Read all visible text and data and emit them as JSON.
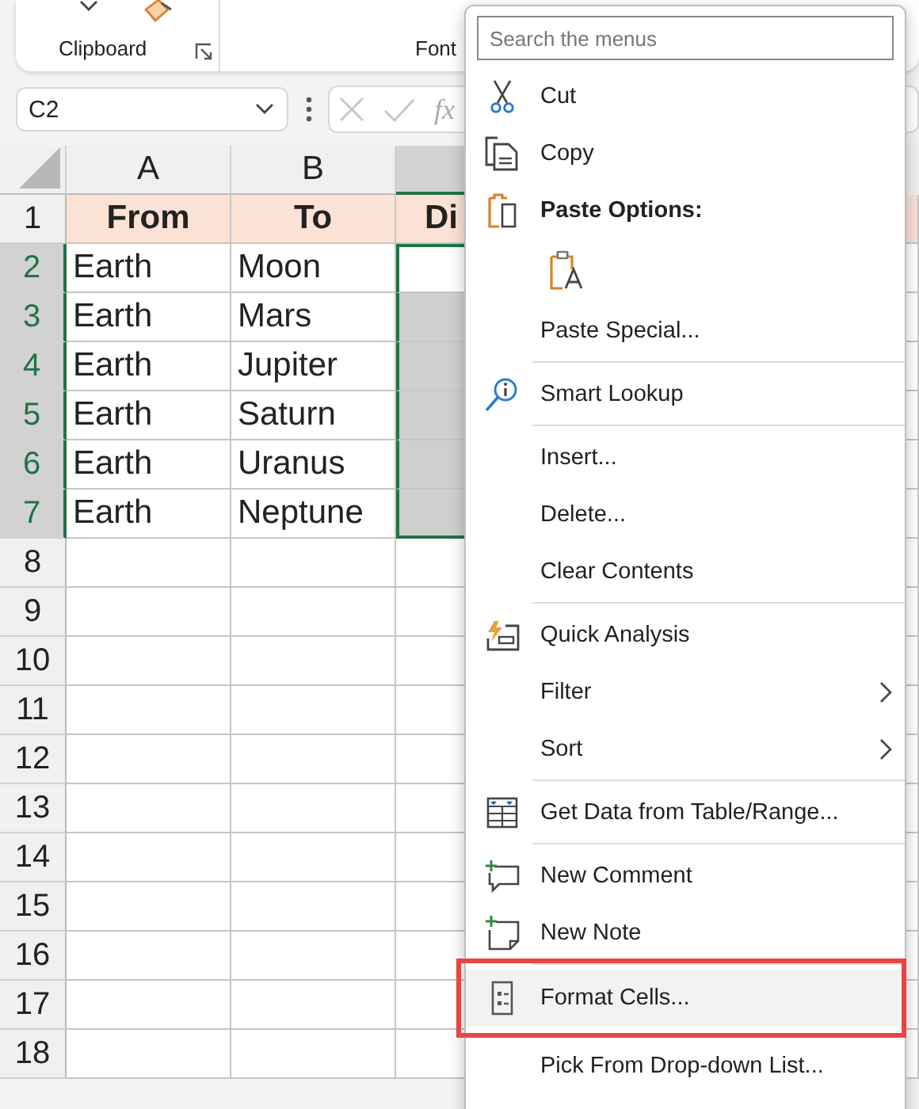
{
  "ribbon": {
    "groups": [
      {
        "label": "Clipboard",
        "launcher": true
      },
      {
        "label": "Font",
        "launcher": false
      }
    ]
  },
  "name_box": {
    "value": "C2"
  },
  "formula_bar": {
    "fx": "fx"
  },
  "sheet": {
    "columns": [
      {
        "label": "A",
        "selected": false
      },
      {
        "label": "B",
        "selected": false
      },
      {
        "selected": true
      }
    ],
    "rows": [
      {
        "number": "1",
        "kind": "header",
        "selected": false,
        "cells": [
          {
            "text": "From"
          },
          {
            "text": "To"
          },
          {
            "text": "Di"
          }
        ]
      },
      {
        "number": "2",
        "kind": "data",
        "selected": true,
        "cells": [
          {
            "text": "Earth"
          },
          {
            "text": "Moon"
          },
          {
            "selected": true,
            "active": true
          }
        ]
      },
      {
        "number": "3",
        "kind": "data",
        "selected": true,
        "cells": [
          {
            "text": "Earth"
          },
          {
            "text": "Mars"
          },
          {
            "selected": true,
            "active": false
          }
        ]
      },
      {
        "number": "4",
        "kind": "data",
        "selected": true,
        "cells": [
          {
            "text": "Earth"
          },
          {
            "text": "Jupiter"
          },
          {
            "selected": true,
            "active": false
          }
        ]
      },
      {
        "number": "5",
        "kind": "data",
        "selected": true,
        "cells": [
          {
            "text": "Earth"
          },
          {
            "text": "Saturn"
          },
          {
            "selected": true,
            "active": false
          }
        ]
      },
      {
        "number": "6",
        "kind": "data",
        "selected": true,
        "cells": [
          {
            "text": "Earth"
          },
          {
            "text": "Uranus"
          },
          {
            "selected": true,
            "active": false
          }
        ]
      },
      {
        "number": "7",
        "kind": "data",
        "selected": true,
        "cells": [
          {
            "text": "Earth"
          },
          {
            "text": "Neptune"
          },
          {
            "selected": true,
            "active": false
          }
        ]
      },
      {
        "number": "8",
        "kind": "empty",
        "selected": false
      },
      {
        "number": "9",
        "kind": "empty",
        "selected": false
      },
      {
        "number": "10",
        "kind": "empty",
        "selected": false
      },
      {
        "number": "11",
        "kind": "empty",
        "selected": false
      },
      {
        "number": "12",
        "kind": "empty",
        "selected": false
      },
      {
        "number": "13",
        "kind": "empty",
        "selected": false
      },
      {
        "number": "14",
        "kind": "empty",
        "selected": false
      },
      {
        "number": "15",
        "kind": "empty",
        "selected": false
      },
      {
        "number": "16",
        "kind": "empty",
        "selected": false
      },
      {
        "number": "17",
        "kind": "empty",
        "selected": false
      },
      {
        "number": "18",
        "kind": "empty",
        "selected": false
      }
    ]
  },
  "context_menu": {
    "search": {
      "placeholder": "Search the menus"
    },
    "items": [
      {
        "kind": "item",
        "label": "Cut",
        "selected": false
      },
      {
        "kind": "item",
        "label": "Copy",
        "selected": false
      },
      {
        "kind": "header",
        "label": "Paste Options:"
      },
      {
        "kind": "paste-icons"
      },
      {
        "kind": "item",
        "label": "Paste Special...",
        "selected": false
      },
      {
        "kind": "separator"
      },
      {
        "kind": "item",
        "label": "Smart Lookup",
        "selected": false
      },
      {
        "kind": "separator"
      },
      {
        "kind": "item",
        "label": "Insert...",
        "selected": false
      },
      {
        "kind": "item",
        "label": "Delete...",
        "selected": false
      },
      {
        "kind": "item",
        "label": "Clear Contents",
        "selected": false
      },
      {
        "kind": "separator"
      },
      {
        "kind": "item",
        "label": "Quick Analysis",
        "selected": false
      },
      {
        "kind": "item",
        "label": "Filter",
        "submenu": true,
        "selected": false
      },
      {
        "kind": "item",
        "label": "Sort",
        "submenu": true,
        "selected": false
      },
      {
        "kind": "separator"
      },
      {
        "kind": "item",
        "label": "Get Data from Table/Range...",
        "selected": false
      },
      {
        "kind": "separator"
      },
      {
        "kind": "item",
        "label": "New Comment",
        "selected": false
      },
      {
        "kind": "item",
        "label": "New Note",
        "selected": false
      },
      {
        "kind": "separator"
      },
      {
        "kind": "item",
        "label": "Format Cells...",
        "selected": true,
        "outlined": true
      },
      {
        "kind": "item",
        "label": "Pick From Drop-down List...",
        "selected": false
      }
    ]
  }
}
